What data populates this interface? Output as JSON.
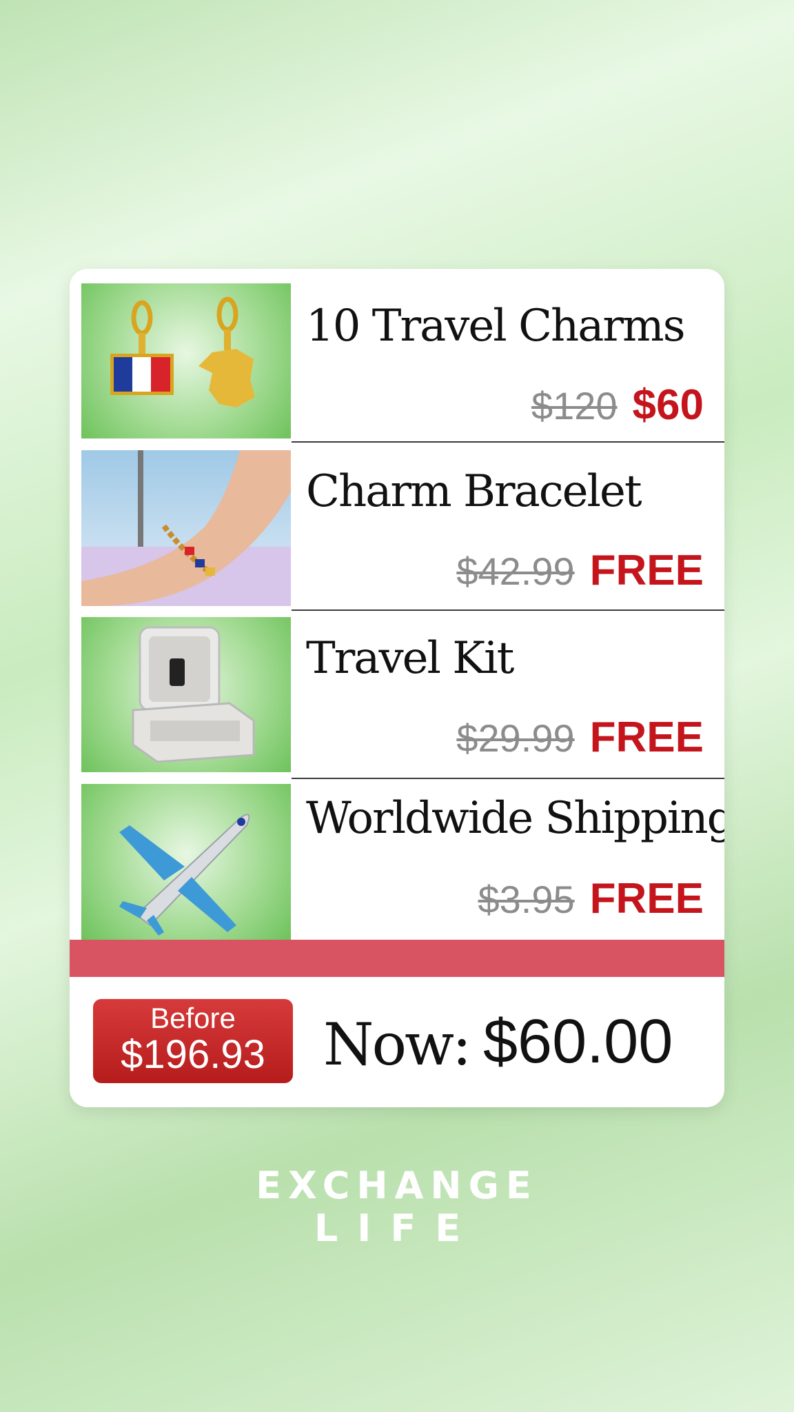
{
  "items": [
    {
      "name": "10 Travel Charms",
      "old_price": "$120",
      "new_price": "$60"
    },
    {
      "name": "Charm Bracelet",
      "old_price": "$42.99",
      "new_price": "FREE"
    },
    {
      "name": "Travel Kit",
      "old_price": "$29.99",
      "new_price": "FREE"
    },
    {
      "name": "Worldwide Shipping",
      "old_price": "$3.95",
      "new_price": "FREE"
    }
  ],
  "summary": {
    "before_label": "Before",
    "before_value": "$196.93",
    "now_label": "Now:",
    "now_value": "$60.00"
  },
  "brand": {
    "line1": "EXCHANGE",
    "line2": "LIFE"
  },
  "colors": {
    "accent_red": "#c4141c",
    "bar": "#d95462"
  }
}
